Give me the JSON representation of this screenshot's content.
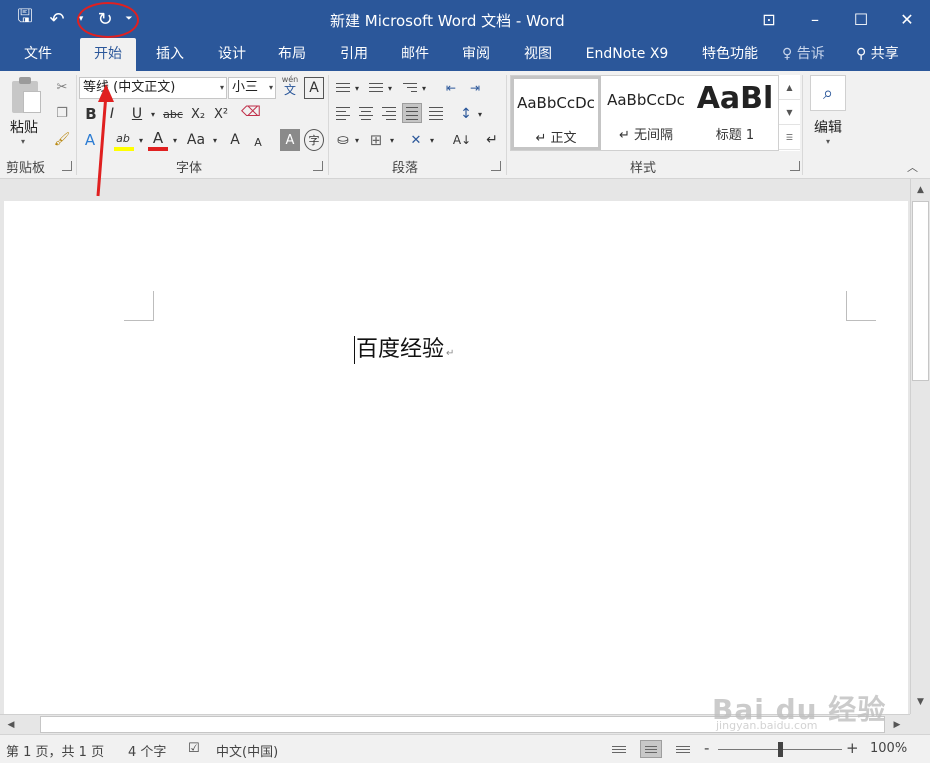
{
  "titlebar": {
    "title": "新建 Microsoft Word 文档 - Word",
    "qat": [
      {
        "name": "save-icon",
        "glyph": "🖫"
      },
      {
        "name": "undo-icon",
        "glyph": "↶"
      },
      {
        "name": "undo-dropdown-icon",
        "glyph": "▾"
      },
      {
        "name": "redo-icon",
        "glyph": "↻"
      },
      {
        "name": "customize-qat-icon",
        "glyph": "⏷"
      }
    ],
    "controls": {
      "ribbon_display": "⊡",
      "minimize": "–",
      "maximize": "☐",
      "close": "✕"
    }
  },
  "tabs": [
    {
      "label": "文件",
      "active": false
    },
    {
      "label": "开始",
      "active": true
    },
    {
      "label": "插入",
      "active": false
    },
    {
      "label": "设计",
      "active": false
    },
    {
      "label": "布局",
      "active": false
    },
    {
      "label": "引用",
      "active": false
    },
    {
      "label": "邮件",
      "active": false
    },
    {
      "label": "审阅",
      "active": false
    },
    {
      "label": "视图",
      "active": false
    },
    {
      "label": "EndNote X9",
      "active": false
    },
    {
      "label": "特色功能",
      "active": false
    }
  ],
  "tellme": {
    "icon": "lightbulb-icon",
    "glyph": "♀",
    "label": "告诉"
  },
  "share": {
    "icon": "person-add-icon",
    "glyph": "⚲",
    "label": "共享"
  },
  "ribbon": {
    "clipboard": {
      "paste_label": "粘贴",
      "group_label": "剪贴板"
    },
    "font": {
      "font_name": "等线 (中文正文)",
      "font_size": "小三",
      "phonetic_top": "wén",
      "phonetic_bottom": "文",
      "char_border": "A",
      "bold": "B",
      "italic": "I",
      "underline": "U",
      "strikethrough": "abc",
      "subscript": "X₂",
      "superscript": "X²",
      "text_effects": "A",
      "highlight": "ab",
      "font_color": "A",
      "change_case": "Aa",
      "grow_font": "A",
      "shrink_font": "A",
      "char_shading": "A",
      "enclose_char": "字",
      "group_label": "字体"
    },
    "paragraph": {
      "group_label": "段落",
      "sort_glyph": "A↓",
      "show_marks_glyph": "↵"
    },
    "styles": {
      "group_label": "样式",
      "items": [
        {
          "preview": "AaBbCcDc",
          "name": "↵ 正文",
          "selected": true
        },
        {
          "preview": "AaBbCcDc",
          "name": "↵ 无间隔",
          "selected": false
        },
        {
          "preview": "AaBl",
          "name": "标题 1",
          "selected": false
        }
      ]
    },
    "editing": {
      "label": "编辑",
      "icon": "⌕"
    }
  },
  "document": {
    "text": "百度经验"
  },
  "statusbar": {
    "page_info": "第 1 页，共 1 页",
    "word_count": "4 个字",
    "language": "中文(中国)",
    "zoom_minus": "-",
    "zoom_plus": "+",
    "zoom_level": "100%"
  },
  "watermark": {
    "main": "Bai du 经验",
    "sub": "jingyan.baidu.com"
  },
  "colors": {
    "accent": "#2b579a",
    "highlight_yellow": "#ffff00",
    "font_red": "#e02020",
    "annotation_red": "#e02020"
  }
}
